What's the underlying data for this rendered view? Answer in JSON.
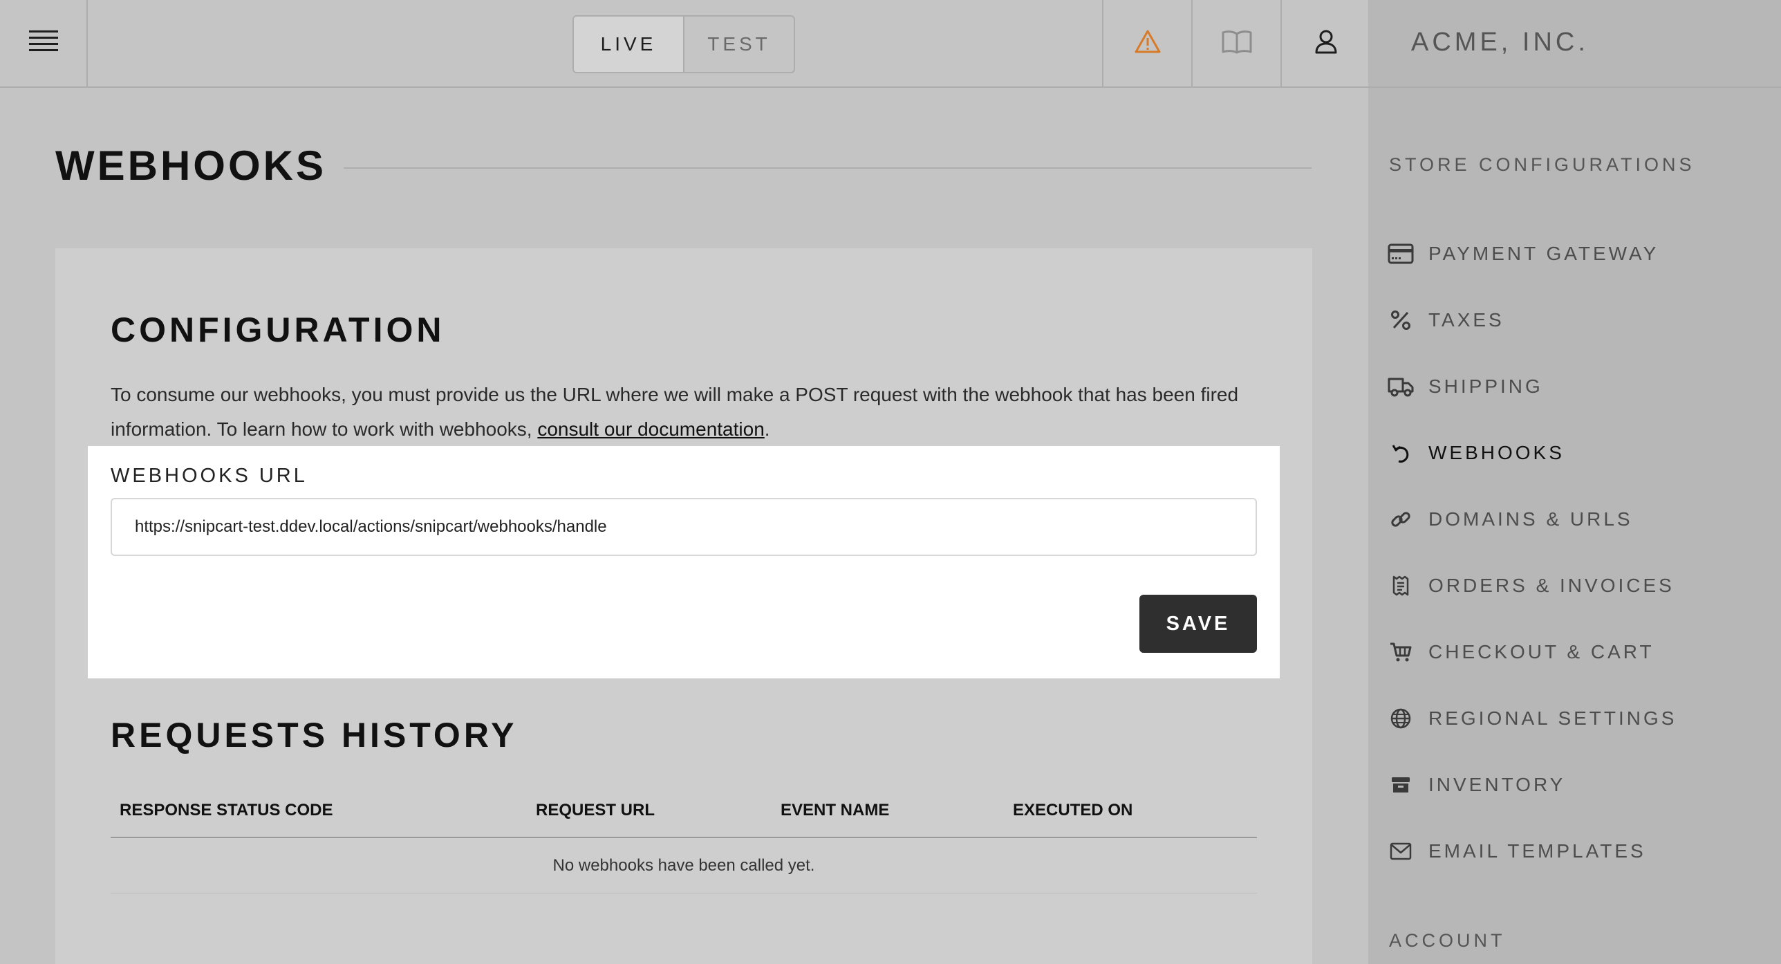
{
  "header": {
    "menu_icon": "hamburger-menu-icon",
    "env_toggle": [
      {
        "label": "LIVE",
        "active": true
      },
      {
        "label": "TEST",
        "active": false
      }
    ],
    "icons": [
      "warning-icon",
      "book-icon",
      "user-icon"
    ],
    "warning_color": "#d67b2a"
  },
  "sidebar": {
    "company": "ACME, INC.",
    "section_title": "STORE CONFIGURATIONS",
    "items": [
      {
        "label": "PAYMENT GATEWAY",
        "icon": "credit-card-icon"
      },
      {
        "label": "TAXES",
        "icon": "percent-icon"
      },
      {
        "label": "SHIPPING",
        "icon": "truck-icon"
      },
      {
        "label": "WEBHOOKS",
        "icon": "webhook-return-icon",
        "active": true
      },
      {
        "label": "DOMAINS & URLS",
        "icon": "link-icon"
      },
      {
        "label": "ORDERS & INVOICES",
        "icon": "receipt-icon"
      },
      {
        "label": "CHECKOUT & CART",
        "icon": "cart-icon"
      },
      {
        "label": "REGIONAL SETTINGS",
        "icon": "globe-icon"
      },
      {
        "label": "INVENTORY",
        "icon": "box-icon"
      },
      {
        "label": "EMAIL TEMPLATES",
        "icon": "envelope-icon"
      }
    ],
    "account_title": "ACCOUNT"
  },
  "main": {
    "page_title": "WEBHOOKS",
    "configuration": {
      "title": "CONFIGURATION",
      "description_before": "To consume our webhooks, you must provide us the URL where we will make a POST request with the webhook that has been fired information. To learn how to work with webhooks, ",
      "doc_link": "consult our documentation",
      "description_after": ".",
      "field_label": "WEBHOOKS URL",
      "url_value": "https://snipcart-test.ddev.local/actions/snipcart/webhooks/handle",
      "save_label": "SAVE"
    },
    "history": {
      "title": "REQUESTS HISTORY",
      "columns": [
        "RESPONSE STATUS CODE",
        "REQUEST URL",
        "EVENT NAME",
        "EXECUTED ON"
      ],
      "empty_message": "No webhooks have been called yet."
    }
  }
}
